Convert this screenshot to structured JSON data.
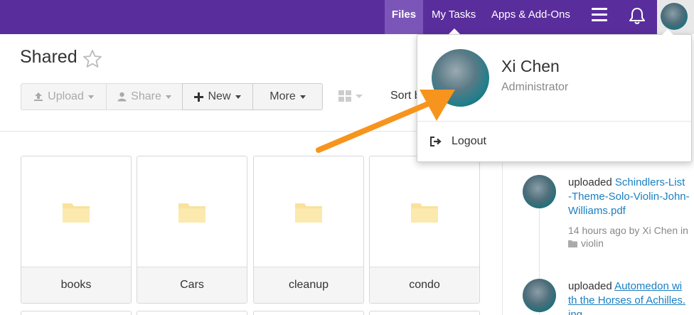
{
  "nav": {
    "files": "Files",
    "my_tasks": "My Tasks",
    "apps": "Apps & Add-Ons",
    "icons": [
      "hamburger-menu-icon",
      "bell-icon",
      "user-avatar"
    ],
    "brand_color": "#5a2d9c",
    "active_tab": "Files"
  },
  "page": {
    "title": "Shared",
    "favorite_icon": "star-outline-icon"
  },
  "toolbar": {
    "upload": "Upload",
    "share": "Share",
    "new": "New",
    "more": "More",
    "sort": "Sort b"
  },
  "folders": [
    {
      "name": "books"
    },
    {
      "name": "Cars"
    },
    {
      "name": "cleanup"
    },
    {
      "name": "condo"
    }
  ],
  "activity": [
    {
      "action": "uploaded",
      "file": "Schindlers-List-Theme-Solo-Violin-John-Williams.pdf",
      "file_lines": [
        "Schindlers-List",
        "-Theme-Solo-Violin-John-",
        "Williams.pdf"
      ],
      "meta": "14 hours ago by Xi Chen in",
      "folder": "violin"
    },
    {
      "action": "uploaded",
      "file_lines": [
        "Automedon wi",
        "th the Horses of Achilles.",
        "ing"
      ]
    }
  ],
  "profile": {
    "name": "Xi Chen",
    "role": "Administrator",
    "logout": "Logout"
  },
  "colors": {
    "nav_bg": "#5a2d9c",
    "nav_active": "#7b55b8",
    "link": "#1a7fc1",
    "folder": "#f9e39c",
    "arrow": "#f7941d"
  }
}
